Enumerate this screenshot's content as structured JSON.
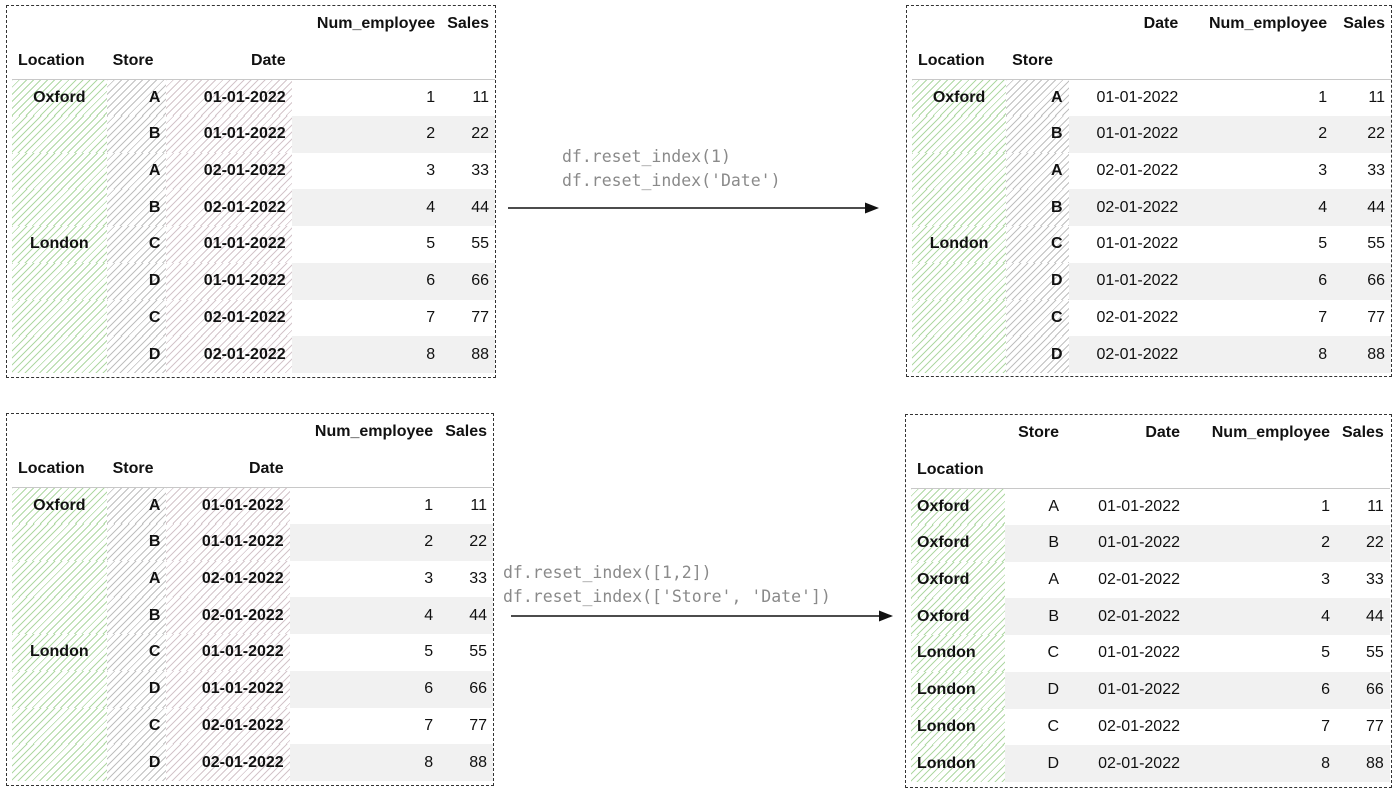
{
  "headers": {
    "location": "Location",
    "store": "Store",
    "date": "Date",
    "num_employee": "Num_employee",
    "sales": "Sales"
  },
  "rows": [
    {
      "location": "Oxford",
      "store": "A",
      "date": "01-01-2022",
      "num_employee": "1",
      "sales": "11"
    },
    {
      "location": "Oxford",
      "store": "B",
      "date": "01-01-2022",
      "num_employee": "2",
      "sales": "22"
    },
    {
      "location": "Oxford",
      "store": "A",
      "date": "02-01-2022",
      "num_employee": "3",
      "sales": "33"
    },
    {
      "location": "Oxford",
      "store": "B",
      "date": "02-01-2022",
      "num_employee": "4",
      "sales": "44"
    },
    {
      "location": "London",
      "store": "C",
      "date": "01-01-2022",
      "num_employee": "5",
      "sales": "55"
    },
    {
      "location": "London",
      "store": "D",
      "date": "01-01-2022",
      "num_employee": "6",
      "sales": "66"
    },
    {
      "location": "London",
      "store": "C",
      "date": "02-01-2022",
      "num_employee": "7",
      "sales": "77"
    },
    {
      "location": "London",
      "store": "D",
      "date": "02-01-2022",
      "num_employee": "8",
      "sales": "88"
    }
  ],
  "group_labels": {
    "oxford": "Oxford",
    "london": "London"
  },
  "code_top": [
    "df.reset_index(1)",
    "df.reset_index('Date')"
  ],
  "code_bottom": [
    "df.reset_index([1,2])",
    "df.reset_index(['Store', 'Date'])"
  ],
  "colors": {
    "location_hatch": "#6eb95a",
    "store_hatch": "#8c8c8c",
    "date_hatch": "#aa8c96",
    "code_text": "#8a8a8a",
    "border": "#333333"
  }
}
